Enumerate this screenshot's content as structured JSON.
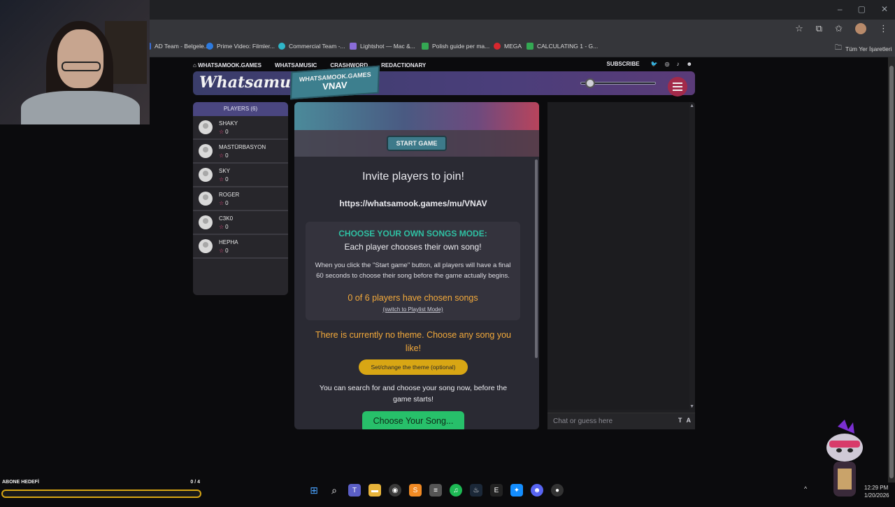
{
  "browser": {
    "bookmarks": [
      {
        "label": "AD Team - Belgele...",
        "color": "#3b6fd8"
      },
      {
        "label": "Prime Video: Filmler...",
        "color": "#2d7be0"
      },
      {
        "label": "Commercial Team -...",
        "color": "#2fb6c8"
      },
      {
        "label": "Lightshot — Mac &...",
        "color": "#8a6cd8"
      },
      {
        "label": "Polish guide per ma...",
        "color": "#34a853"
      },
      {
        "label": "MEGA",
        "color": "#d9272e"
      },
      {
        "label": "CALCULATING 1 - G...",
        "color": "#34a853"
      },
      {
        "label": "Tüm Yer İşaretleri",
        "color": "#9aa0a6"
      }
    ]
  },
  "site": {
    "nav": [
      "WHATSAMOOK.GAMES",
      "WHATSAMUSIC",
      "CRASHWORD",
      "REDACTIONARY"
    ],
    "subscribe": "SUBSCRIBE",
    "logo": "Whatsamusic",
    "room_site": "WHATSAMOOK.GAMES",
    "room_code": "VNAV",
    "volume_level": 0.1
  },
  "players": {
    "header": "PLAYERS (6)",
    "list": [
      {
        "name": "SHAKY",
        "score": "0"
      },
      {
        "name": "MASTÜRBASYON",
        "score": "0"
      },
      {
        "name": "SKY",
        "score": "0"
      },
      {
        "name": "ROGER",
        "score": "0"
      },
      {
        "name": "C3K0",
        "score": "0"
      },
      {
        "name": "HEPHA",
        "score": "0"
      }
    ]
  },
  "game": {
    "start_label": "START GAME",
    "invite_title": "Invite players to join!",
    "invite_url": "https://whatsamook.games/mu/VNAV",
    "mode_title": "CHOOSE YOUR OWN SONGS MODE:",
    "mode_subtitle": "Each player chooses their own song!",
    "mode_desc": "When you click the \"Start game\" button, all players will have a final 60 seconds to choose their song before the game actually begins.",
    "mode_count": "0 of 6 players have chosen songs",
    "mode_switch": "(switch to Playlist Mode)",
    "theme_msg": "There is currently no theme. Choose any song you like!",
    "theme_btn": "Set/change the theme (optional)",
    "search_msg": "You can search for and choose your song now, before the game starts!",
    "choose_btn": "Choose Your Song..."
  },
  "chat": {
    "placeholder": "Chat or guess here",
    "ta": "T A"
  },
  "overlay": {
    "abone_label": "ABONE HEDEFİ",
    "abone_count": "0 / 4",
    "abone_progress": 0
  },
  "taskbar": {
    "clock_time": "12:29 PM",
    "clock_date": "1/20/2026"
  }
}
